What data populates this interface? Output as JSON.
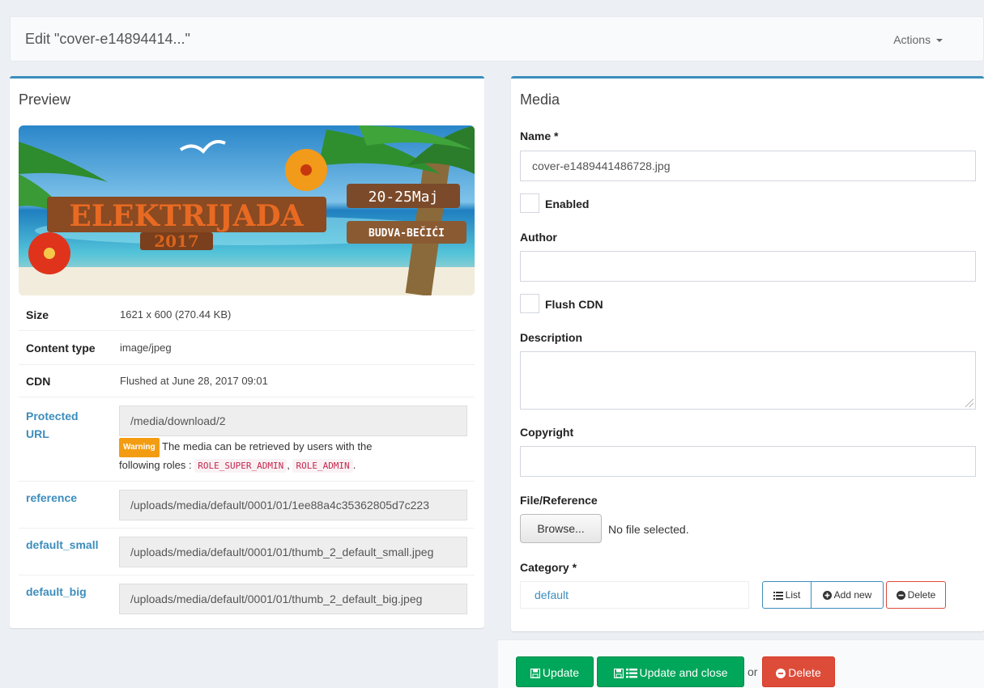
{
  "header": {
    "title": "Edit \"cover-e14894414...\"",
    "actions_label": "Actions"
  },
  "preview": {
    "title": "Preview",
    "banner": {
      "headline": "ELEKTRIJADA",
      "year": "2017",
      "dates": "20-25Maj",
      "location": "BUDVA-BEČIĆI"
    },
    "size": {
      "label": "Size",
      "value": "1621 x 600 (270.44 KB)"
    },
    "content_type": {
      "label": "Content type",
      "value": "image/jpeg"
    },
    "cdn": {
      "label": "CDN",
      "value": "Flushed at June 28, 2017 09:01"
    },
    "protected_url": {
      "label_line1": "Protected",
      "label_line2": "URL",
      "value": "/media/download/2",
      "warning_badge": "Warning",
      "warning_text": "The media can be retrieved by users with the",
      "roles_prefix": "following roles :",
      "roles": [
        "ROLE_SUPER_ADMIN",
        "ROLE_ADMIN"
      ],
      "roles_sep": ",",
      "roles_end": "."
    },
    "reference": {
      "label": "reference",
      "value": "/uploads/media/default/0001/01/1ee88a4c35362805d7c223"
    },
    "default_small": {
      "label": "default_small",
      "value": "/uploads/media/default/0001/01/thumb_2_default_small.jpeg"
    },
    "default_big": {
      "label": "default_big",
      "value": "/uploads/media/default/0001/01/thumb_2_default_big.jpeg"
    }
  },
  "media": {
    "title": "Media",
    "name": {
      "label": "Name *",
      "value": "cover-e1489441486728.jpg"
    },
    "enabled": {
      "label": "Enabled",
      "checked": false
    },
    "author": {
      "label": "Author",
      "value": ""
    },
    "flush_cdn": {
      "label": "Flush CDN",
      "checked": false
    },
    "description": {
      "label": "Description",
      "value": ""
    },
    "copyright": {
      "label": "Copyright",
      "value": ""
    },
    "file_reference": {
      "label": "File/Reference",
      "browse_label": "Browse...",
      "no_file": "No file selected."
    },
    "category": {
      "label": "Category *",
      "value": "default",
      "list_label": "List",
      "add_new_label": "Add new",
      "delete_label": "Delete"
    }
  },
  "footer": {
    "update_label": "Update",
    "update_close_label": "Update and close",
    "or_label": "or",
    "delete_label": "Delete"
  },
  "colors": {
    "primary": "#3c8dbc",
    "success": "#00a65a",
    "danger": "#dd4b39",
    "warning": "#f39c12"
  }
}
